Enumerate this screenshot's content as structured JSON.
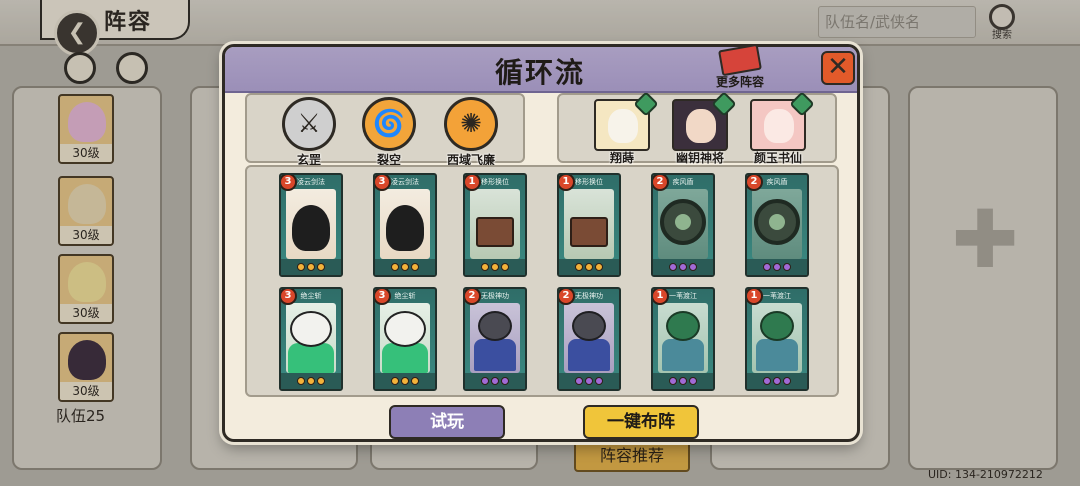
{
  "header": {
    "title": "阵容",
    "search_placeholder": "队伍名/武侠名",
    "search_label": "搜索"
  },
  "team": {
    "members": [
      {
        "level": "30级",
        "color": "#e7b9d8"
      },
      {
        "level": "30级",
        "color": "#e8d8b2"
      },
      {
        "level": "30级",
        "color": "#f1e19a"
      },
      {
        "level": "30级",
        "color": "#3b2c3f"
      }
    ],
    "label": "队伍25"
  },
  "background": {
    "recommend_label": "阵容推荐",
    "uid": "UID:  134-210972212"
  },
  "modal": {
    "title": "循环流",
    "more_label": "更多阵容",
    "weapons": [
      {
        "name": "玄罡",
        "icon": "spiked-mace-icon",
        "color": "#cfcfcf",
        "glyph": "⚔"
      },
      {
        "name": "裂空",
        "icon": "wind-blade-icon",
        "color": "#f2a53a",
        "glyph": "🌀"
      },
      {
        "name": "西域飞廉",
        "icon": "fan-icon",
        "color": "#f3a238",
        "glyph": "✺"
      }
    ],
    "heroes": [
      {
        "name": "翔蒔",
        "color": "#f5e7c2",
        "face": "#f7f3ea"
      },
      {
        "name": "幽钥神将",
        "color": "#3b2f3c",
        "face": "#f1d8c6"
      },
      {
        "name": "颜玉书仙",
        "color": "#f4c7c3",
        "face": "#fbe9e4"
      }
    ],
    "cards": [
      {
        "cost": "3",
        "title": "凌云剑法",
        "kind": "owl",
        "pips": [
          "#f2b23a",
          "#f2b23a",
          "#f2b23a"
        ]
      },
      {
        "cost": "3",
        "title": "凌云剑法",
        "kind": "owl",
        "pips": [
          "#f2b23a",
          "#f2b23a",
          "#f2b23a"
        ]
      },
      {
        "cost": "1",
        "title": "移形换位",
        "kind": "scroll",
        "pips": [
          "#f2b23a",
          "#f2b23a",
          "#f2b23a"
        ]
      },
      {
        "cost": "1",
        "title": "移形换位",
        "kind": "scroll",
        "pips": [
          "#f2b23a",
          "#f2b23a",
          "#f2b23a"
        ]
      },
      {
        "cost": "2",
        "title": "疾风盾",
        "kind": "disc",
        "pips": [
          "#a16ad6",
          "#a16ad6",
          "#a16ad6"
        ]
      },
      {
        "cost": "2",
        "title": "疾风盾",
        "kind": "disc",
        "pips": [
          "#a16ad6",
          "#a16ad6",
          "#a16ad6"
        ]
      },
      {
        "cost": "3",
        "title": "绝尘斩",
        "kind": "panda",
        "pips": [
          "#f2b23a",
          "#f2b23a",
          "#f2b23a"
        ]
      },
      {
        "cost": "3",
        "title": "绝尘斩",
        "kind": "panda",
        "pips": [
          "#f2b23a",
          "#f2b23a",
          "#f2b23a"
        ]
      },
      {
        "cost": "2",
        "title": "无极神功",
        "kind": "raccoon",
        "pips": [
          "#a16ad6",
          "#a16ad6",
          "#a16ad6"
        ]
      },
      {
        "cost": "2",
        "title": "无极神功",
        "kind": "raccoon",
        "pips": [
          "#a16ad6",
          "#a16ad6",
          "#a16ad6"
        ]
      },
      {
        "cost": "1",
        "title": "一苇渡江",
        "kind": "frog",
        "pips": [
          "#a16ad6",
          "#a16ad6",
          "#a16ad6"
        ]
      },
      {
        "cost": "1",
        "title": "一苇渡江",
        "kind": "frog",
        "pips": [
          "#a16ad6",
          "#a16ad6",
          "#a16ad6"
        ]
      }
    ],
    "try_label": "试玩",
    "deploy_label": "一键布阵"
  }
}
